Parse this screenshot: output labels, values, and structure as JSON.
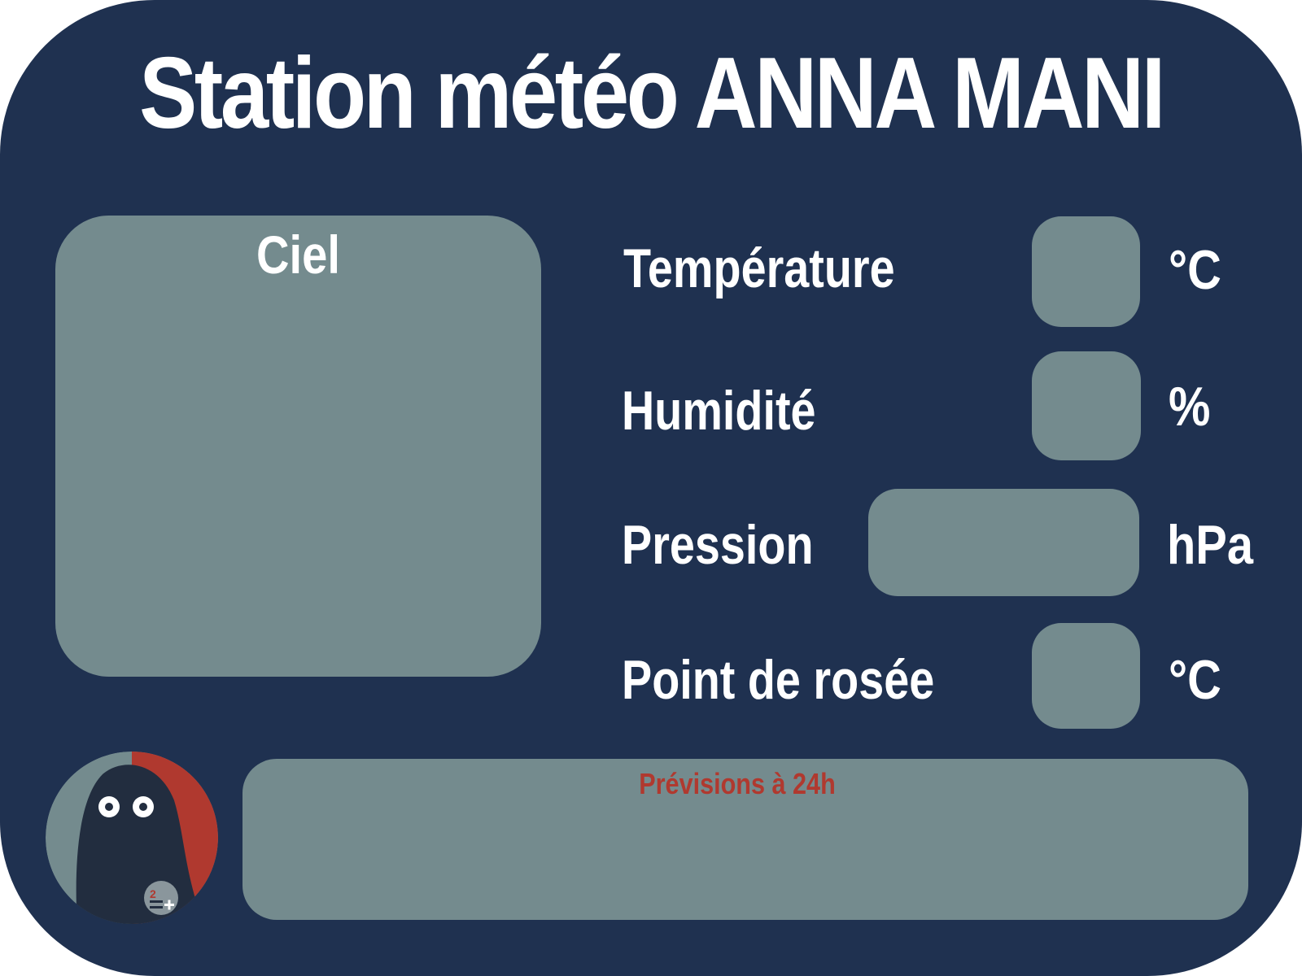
{
  "title": "Station météo ANNA MANI",
  "sky": {
    "label": "Ciel"
  },
  "measures": {
    "temperature": {
      "label": "Température",
      "unit": "°C",
      "value": ""
    },
    "humidity": {
      "label": "Humidité",
      "unit": "%",
      "value": ""
    },
    "pressure": {
      "label": "Pression",
      "unit": "hPa",
      "value": ""
    },
    "dew_point": {
      "label": "Point de rosée",
      "unit": "°C",
      "value": ""
    }
  },
  "forecast": {
    "label": "Prévisions à 24h"
  },
  "logo": {
    "icon": "owl-mascot-icon",
    "badge_icon": "calculator-badge-icon",
    "badge_text": "2"
  },
  "colors": {
    "background": "#1f3150",
    "box": "#748b8e",
    "accent": "#b0392f",
    "text": "#ffffff"
  }
}
